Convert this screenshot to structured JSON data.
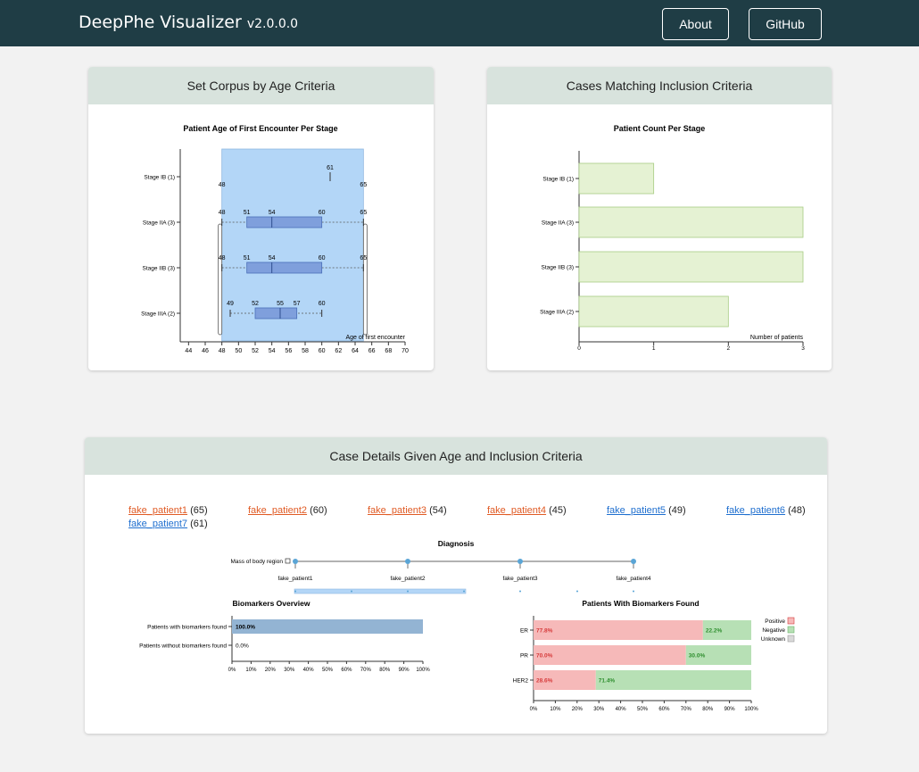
{
  "header": {
    "title": "DeepPhe Visualizer",
    "version": "v2.0.0.0",
    "about_label": "About",
    "github_label": "GitHub"
  },
  "age_panel": {
    "header": "Set Corpus by Age Criteria",
    "chart_title": "Patient Age of First Encounter Per Stage",
    "xlabel": "Age of first encounter",
    "brush": {
      "min": 48,
      "max": 65
    }
  },
  "count_panel": {
    "header": "Cases Matching Inclusion Criteria",
    "chart_title": "Patient Count Per Stage",
    "xlabel": "Number of patients"
  },
  "details_panel": {
    "header": "Case Details Given Age and Inclusion Criteria",
    "patients": [
      {
        "name": "fake_patient1",
        "age": "(65)",
        "color": "red"
      },
      {
        "name": "fake_patient2",
        "age": "(60)",
        "color": "red"
      },
      {
        "name": "fake_patient3",
        "age": "(54)",
        "color": "red"
      },
      {
        "name": "fake_patient4",
        "age": "(45)",
        "color": "red"
      },
      {
        "name": "fake_patient5",
        "age": "(49)",
        "color": "blue"
      },
      {
        "name": "fake_patient6",
        "age": "(48)",
        "color": "blue"
      },
      {
        "name": "fake_patient7",
        "age": "(61)",
        "color": "blue"
      }
    ],
    "diagnosis_title": "Diagnosis",
    "diagnosis_row_label": "Mass of body region",
    "diagnosis_patients": [
      "fake_patient1",
      "fake_patient2",
      "fake_patient3",
      "fake_patient4"
    ],
    "biomarkers_overview_title": "Biomarkers Overview",
    "biomarkers_found_title": "Patients With Biomarkers Found",
    "legend": [
      "Positive",
      "Negative",
      "Unknown"
    ]
  },
  "colors": {
    "header_bg": "#1f3d45",
    "card_head_bg": "#d8e3dd",
    "boxplot_fill": "#7f9fdc",
    "brush_fill": "#b3d6f7",
    "count_bar_fill": "#e5f2d3",
    "count_bar_stroke": "#a8cc84",
    "overview_bar": "#93b4d3",
    "positive": "#f6b9b9",
    "negative": "#b7e0b5",
    "unknown": "#d9d9d9",
    "diag_dot": "#5aa5d6"
  },
  "chart_data": [
    {
      "type": "boxplot",
      "title": "Patient Age of First Encounter Per Stage",
      "xlabel": "Age of first encounter",
      "xlim": [
        43,
        70
      ],
      "xticks": [
        44,
        46,
        48,
        50,
        52,
        54,
        56,
        58,
        60,
        62,
        64,
        66,
        68,
        70
      ],
      "categories": [
        "Stage IB (1)",
        "Stage IIA (3)",
        "Stage IIB (3)",
        "Stage IIIA (2)"
      ],
      "series": [
        {
          "name": "Stage IB (1)",
          "min": 61,
          "q1": 61,
          "median": 61,
          "q3": 61,
          "max": 61,
          "labels": [
            "61"
          ]
        },
        {
          "name": "Stage IIA (3)",
          "min": 48,
          "q1": 51,
          "median": 54,
          "q3": 60,
          "max": 65,
          "labels": [
            "48",
            "51",
            "54",
            "60",
            "65"
          ]
        },
        {
          "name": "Stage IIB (3)",
          "min": 48,
          "q1": 51,
          "median": 54,
          "q3": 60,
          "max": 65,
          "labels": [
            "48",
            "51",
            "54",
            "60",
            "65"
          ]
        },
        {
          "name": "Stage IIIA (2)",
          "min": 49,
          "q1": 52,
          "median": 55,
          "q3": 57,
          "max": 60,
          "labels": [
            "49",
            "52",
            "55",
            "57",
            "60"
          ]
        }
      ],
      "brush_labels": [
        "48",
        "65"
      ]
    },
    {
      "type": "bar",
      "orientation": "horizontal",
      "title": "Patient Count Per Stage",
      "xlabel": "Number of patients",
      "categories": [
        "Stage IB (1)",
        "Stage IIA (3)",
        "Stage IIB (3)",
        "Stage IIIA (2)"
      ],
      "values": [
        1,
        3,
        3,
        2
      ],
      "xlim": [
        0,
        3
      ],
      "xticks": [
        "0",
        "1",
        "2",
        "3"
      ]
    },
    {
      "type": "bar",
      "orientation": "horizontal",
      "title": "Biomarkers Overview",
      "categories": [
        "Patients with biomarkers found",
        "Patients without biomarkers found"
      ],
      "values": [
        100.0,
        0.0
      ],
      "data_labels": [
        "100.0%",
        "0.0%"
      ],
      "xticks": [
        "0%",
        "10%",
        "20%",
        "30%",
        "40%",
        "50%",
        "60%",
        "70%",
        "80%",
        "90%",
        "100%"
      ]
    },
    {
      "type": "bar",
      "orientation": "horizontal",
      "stacked": true,
      "title": "Patients With Biomarkers Found",
      "categories": [
        "ER",
        "PR",
        "HER2"
      ],
      "series": [
        {
          "name": "Positive",
          "values": [
            77.8,
            70.0,
            28.6
          ],
          "labels": [
            "77.8%",
            "70.0%",
            "28.6%"
          ]
        },
        {
          "name": "Negative",
          "values": [
            22.2,
            30.0,
            71.4
          ],
          "labels": [
            "22.2%",
            "30.0%",
            "71.4%"
          ]
        },
        {
          "name": "Unknown",
          "values": [
            0,
            0,
            0
          ]
        }
      ],
      "legend": "top-right",
      "xticks": [
        "0%",
        "10%",
        "20%",
        "30%",
        "40%",
        "50%",
        "60%",
        "70%",
        "80%",
        "90%",
        "100%"
      ]
    }
  ]
}
